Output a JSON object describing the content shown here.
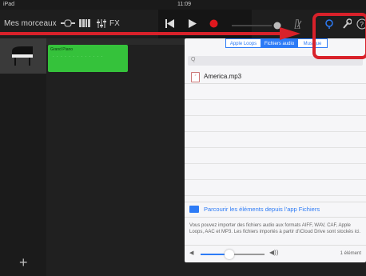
{
  "status_bar": {
    "left": "iPad",
    "time": "11:09"
  },
  "toolbar": {
    "my_songs": "Mes morceaux",
    "fx": "FX"
  },
  "track": {
    "region_name": "Grand Piano"
  },
  "browser": {
    "tabs": [
      {
        "label": "Apple Loops"
      },
      {
        "label": "Fichiers audio"
      },
      {
        "label": "Musique"
      }
    ],
    "search_placeholder": "Q",
    "files": [
      {
        "name": "America.mp3"
      }
    ],
    "browse_link": "Parcourir les éléments depuis l’app Fichiers",
    "info": "Vous pouvez importer des fichiers audio aux formats AIFF, WAV, CAF, Apple Loops, AAC et MP3. Les fichiers importés à partir d’iCloud Drive sont stockés ici.",
    "count": "1 élément",
    "volume_level": 0.45
  },
  "colors": {
    "accent": "#2d7bf6",
    "region": "#35c23b",
    "annotation": "#d8212a"
  }
}
